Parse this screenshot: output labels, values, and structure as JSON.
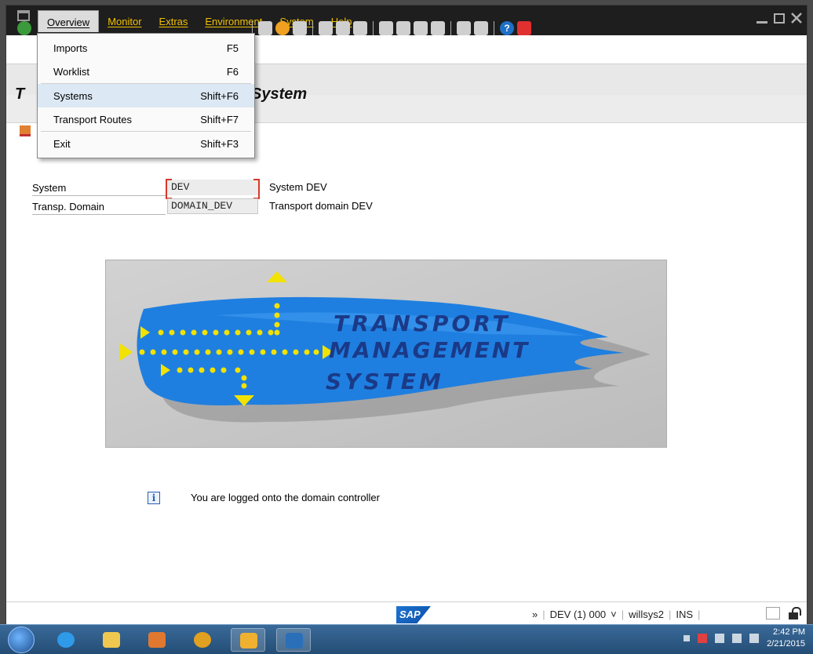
{
  "menubar": {
    "items": [
      {
        "label": "Overview",
        "active": true
      },
      {
        "label": "Monitor",
        "active": false
      },
      {
        "label": "Extras",
        "active": false
      },
      {
        "label": "Environment",
        "active": false
      },
      {
        "label": "System",
        "active": false
      },
      {
        "label": "Help",
        "active": false
      }
    ],
    "window_controls": [
      "minimize-icon",
      "restore-icon",
      "close-icon"
    ]
  },
  "dropdown": {
    "items": [
      {
        "label": "Imports",
        "shortcut": "F5"
      },
      {
        "label": "Worklist",
        "shortcut": "F6"
      },
      {
        "label": "Systems",
        "shortcut": "Shift+F6",
        "highlighted": true
      },
      {
        "label": "Transport Routes",
        "shortcut": "Shift+F7"
      },
      {
        "label": "Exit",
        "shortcut": "Shift+F3"
      }
    ]
  },
  "title": {
    "visible_prefix": "T",
    "visible_suffix": "System"
  },
  "form": {
    "system": {
      "label": "System",
      "value": "DEV",
      "description": "System DEV"
    },
    "domain": {
      "label": "Transp. Domain",
      "value": "DOMAIN_DEV",
      "description": "Transport domain DEV"
    }
  },
  "banner": {
    "line1": "TRANSPORT",
    "line2": "MANAGEMENT",
    "line3": "SYSTEM"
  },
  "info_message": "You are logged onto the domain controller",
  "statusbar": {
    "logo": "SAP",
    "expand": "»",
    "session": "DEV (1) 000",
    "session_caret": "˅",
    "host": "willsys2",
    "mode": "INS"
  },
  "taskbar": {
    "time": "2:42 PM",
    "date": "2/21/2015"
  },
  "colors": {
    "menu_text": "#f0c000",
    "banner_blue": "#1f7fe0",
    "banner_yellow": "#f2e200",
    "highlight": "#dce8f3"
  }
}
